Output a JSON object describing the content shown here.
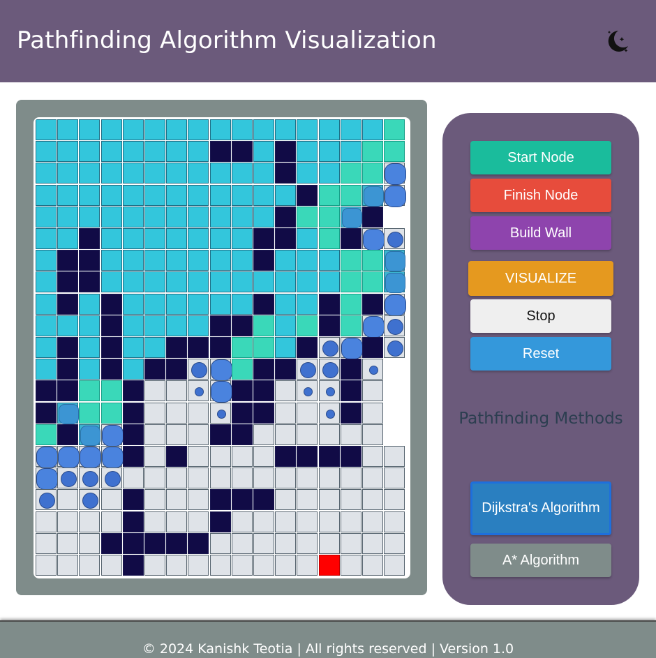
{
  "header": {
    "title": "Pathfinding Algorithm Visualization",
    "theme_toggle_icon": "moon-stars-icon"
  },
  "controls": {
    "start_node_label": "Start Node",
    "finish_node_label": "Finish Node",
    "build_wall_label": "Build Wall",
    "visualize_label": "VISUALIZE",
    "stop_label": "Stop",
    "reset_label": "Reset",
    "methods_heading": "Pathfinding Methods",
    "dijkstra_label": "Dijkstra's Algorithm",
    "astar_label": "A* Algorithm",
    "selected_method": "Dijkstra's Algorithm"
  },
  "grid": {
    "legend": {
      "V": "visited",
      "W": "wall",
      "F": "frontier",
      "U": "unvisited",
      "E": "finish-node",
      "a": "queued-small",
      "b": "queued-medium",
      "c": "queued-large",
      "d": "queued-settling"
    },
    "rows": [
      "VVVVVVVVVVVVVVVVF",
      "VVVVVVVVWWVWVVVFF",
      "VVVVVVVVVVVWVVFFc",
      "VVVVVVVVVVVVWFFdc",
      "VVVVVVVVVVVWFFdW",
      "VVWVVVVVVVWWVFWcb",
      "VWWVVVVVVVWVVVFFd",
      "VWWVVVVVVVVVVVFFd",
      "VWVWVVVVVVWVVWFWc",
      "VVVWVVVVWWFVFWFcb",
      "VWVWVVWWWFFVWbcWb",
      "VWVWVWWbcFWWbbWa",
      "WWFFWUUacWWUaaWU",
      "WdFFWUUUaWWUUaWU",
      "FWdcWUUUWWUUUUUU",
      "ccccWUWUUUUWWWWUU",
      "cbbbUUUUUUUUUUUUU",
      "bUbUWUUUWWWUUUUUU",
      "UUUUWUUUWUUUUUUUU",
      "UUUWWWWWUUUUUUUUU",
      "UUUUWUUUUUUUUEUUU"
    ]
  },
  "footer": {
    "text": "© 2024 Kanishk Teotia | All rights reserved | Version 1.0"
  }
}
